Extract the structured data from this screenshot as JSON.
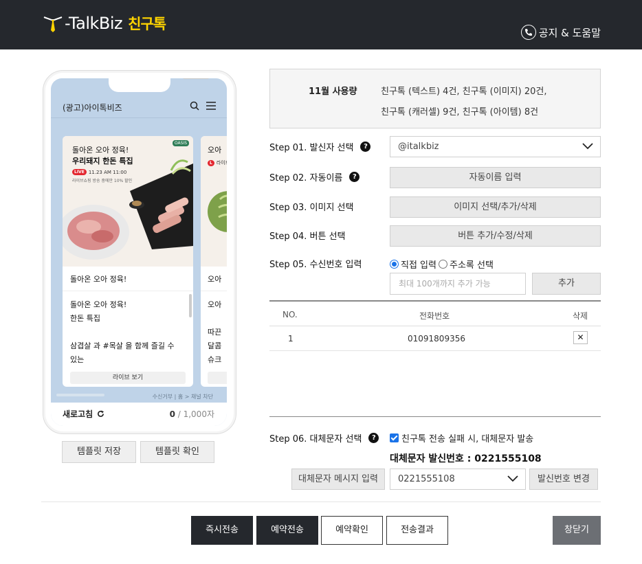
{
  "header": {
    "logo_text": "-TalkBiz",
    "logo_sub": "친구톡",
    "help_label": "공지 & 도움말"
  },
  "preview": {
    "chat_title": "(광고)아이톡비즈",
    "card": {
      "image_headline1": "돌아온 오아 정육!",
      "image_headline2": "우리돼지 한돈 특집",
      "live_badge": "LIVE",
      "live_time": "11.23 AM 11:00",
      "image_sub": "라이브쇼핑 방송 중에만 10% 할인",
      "brand_tag": "OASIS",
      "title": "돌아온 오아 정육!",
      "body_line1": "돌아온 오아 정육!",
      "body_line2": "한돈 특집",
      "body_line3": "삼겹살 과 #목살 을 함께 즐길 수",
      "body_line4": "있는",
      "button": "라이브 보기"
    },
    "card2": {
      "title": "오아",
      "line1": "오아",
      "line2": "따끈",
      "line3": "달콤",
      "line4": "슈크",
      "image_headline": "오아",
      "live_snippet": "라이브"
    },
    "reject_text": "수신거부 | 홈 > 채널 차단",
    "refresh_label": "새로고침",
    "counter_current": "0",
    "counter_total": " / 1,000자"
  },
  "template_buttons": {
    "save": "템플릿 저장",
    "check": "템플릿 확인"
  },
  "usage": {
    "label": "11월 사용량",
    "line1": "친구톡 (텍스트) 4건, 친구톡 (이미지) 20건,",
    "line2": "친구톡 (캐러셀) 9건, 친구톡 (아이템) 8건"
  },
  "steps": {
    "step1": "Step 01. 발신자 선택",
    "step2": "Step 02. 자동이름",
    "step3": "Step 03. 이미지 선택",
    "step4": "Step 04. 버튼 선택",
    "step5": "Step 05. 수신번호 입력",
    "step6": "Step 06. 대체문자 선택"
  },
  "help_mark": "?",
  "sender_select_value": "@italkbiz",
  "auto_name_button": "자동이름 입력",
  "image_button": "이미지 선택/추가/삭제",
  "button_button": "버튼 추가/수정/삭제",
  "recipient": {
    "radio_direct": "직접 입력",
    "radio_address": "주소록 선택",
    "input_placeholder": "최대 100개까지 추가 가능",
    "add_button": "추가"
  },
  "table": {
    "headers": [
      "NO.",
      "전화번호",
      "삭제"
    ],
    "rows": [
      {
        "no": "1",
        "phone": "01091809356",
        "delete": "✕"
      }
    ]
  },
  "fallback": {
    "checkbox_label": "친구톡 전송 실패 시, 대체문자 발송",
    "number_label": "대체문자 발신번호 : 0221555108",
    "message_button": "대체문자 메시지 입력",
    "select_value": "0221555108",
    "change_button": "발신번호 변경"
  },
  "actions": {
    "send_now": "즉시전송",
    "reserve": "예약전송",
    "reserve_check": "예약확인",
    "result": "전송결과",
    "close": "창닫기"
  },
  "colors": {
    "header_bg": "#25282d",
    "logo_accent": "#ffd400",
    "preview_bg": "#bfd3e8",
    "accent_blue": "#1a73e8"
  }
}
